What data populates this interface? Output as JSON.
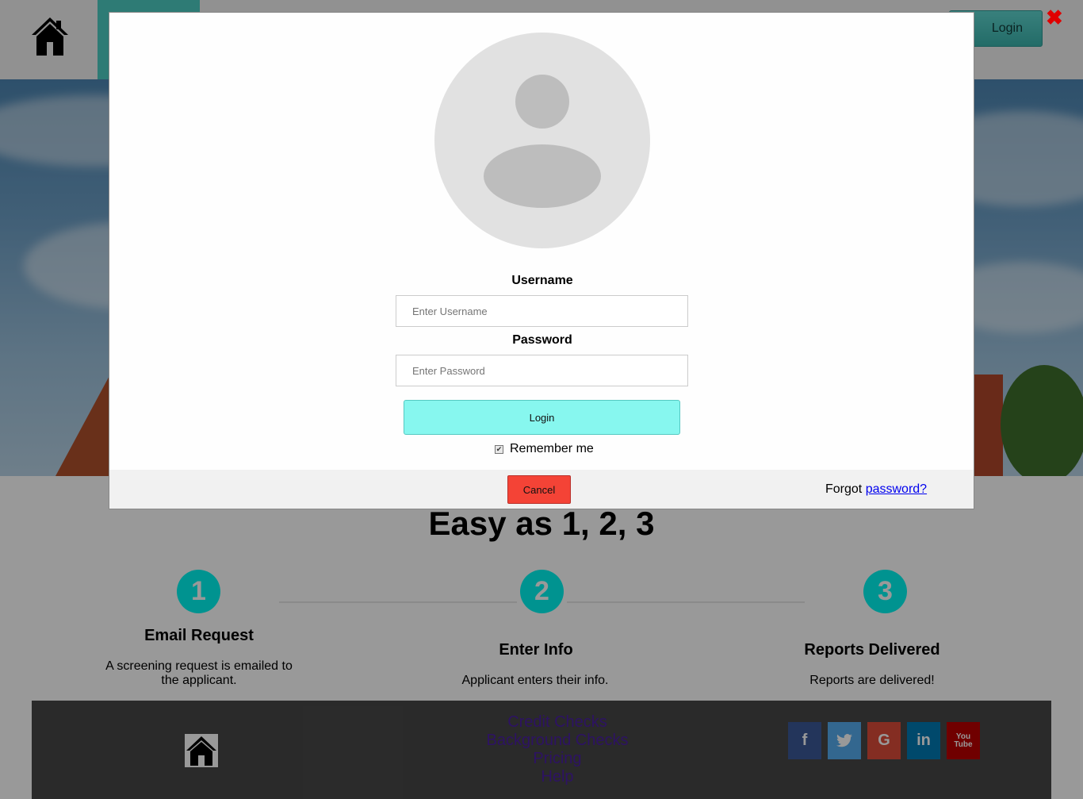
{
  "header": {
    "login_label": "Login",
    "logo_icon": "house-icon",
    "accent_color": "#4ecdc4"
  },
  "modal": {
    "avatar_icon": "user-avatar-icon",
    "username_label": "Username",
    "username_placeholder": "Enter Username",
    "password_label": "Password",
    "password_placeholder": "Enter Password",
    "submit_label": "Login",
    "remember_label": "Remember me",
    "remember_checked": true,
    "cancel_label": "Cancel",
    "forgot_prefix": "Forgot ",
    "forgot_link": "password?",
    "close_icon": "close-icon"
  },
  "section": {
    "title": "Easy as 1, 2, 3"
  },
  "steps": [
    {
      "number": "1",
      "title": "Email Request",
      "text": "A screening request is emailed to the applicant."
    },
    {
      "number": "2",
      "title": "Enter Info",
      "text": "Applicant enters their info."
    },
    {
      "number": "3",
      "title": "Reports Delivered",
      "text": "Reports are delivered!"
    }
  ],
  "footer": {
    "links": [
      "Credit Checks",
      "Background Checks",
      "Pricing",
      "Help"
    ],
    "social": [
      {
        "icon": "facebook-icon",
        "glyph": "f",
        "color": "#3b5998"
      },
      {
        "icon": "twitter-icon",
        "glyph": "t",
        "color": "#55acee"
      },
      {
        "icon": "google-icon",
        "glyph": "G",
        "color": "#dd4b39"
      },
      {
        "icon": "linkedin-icon",
        "glyph": "in",
        "color": "#007bb5"
      },
      {
        "icon": "youtube-icon",
        "glyph": "You\nTube",
        "color": "#bb0000"
      }
    ]
  }
}
